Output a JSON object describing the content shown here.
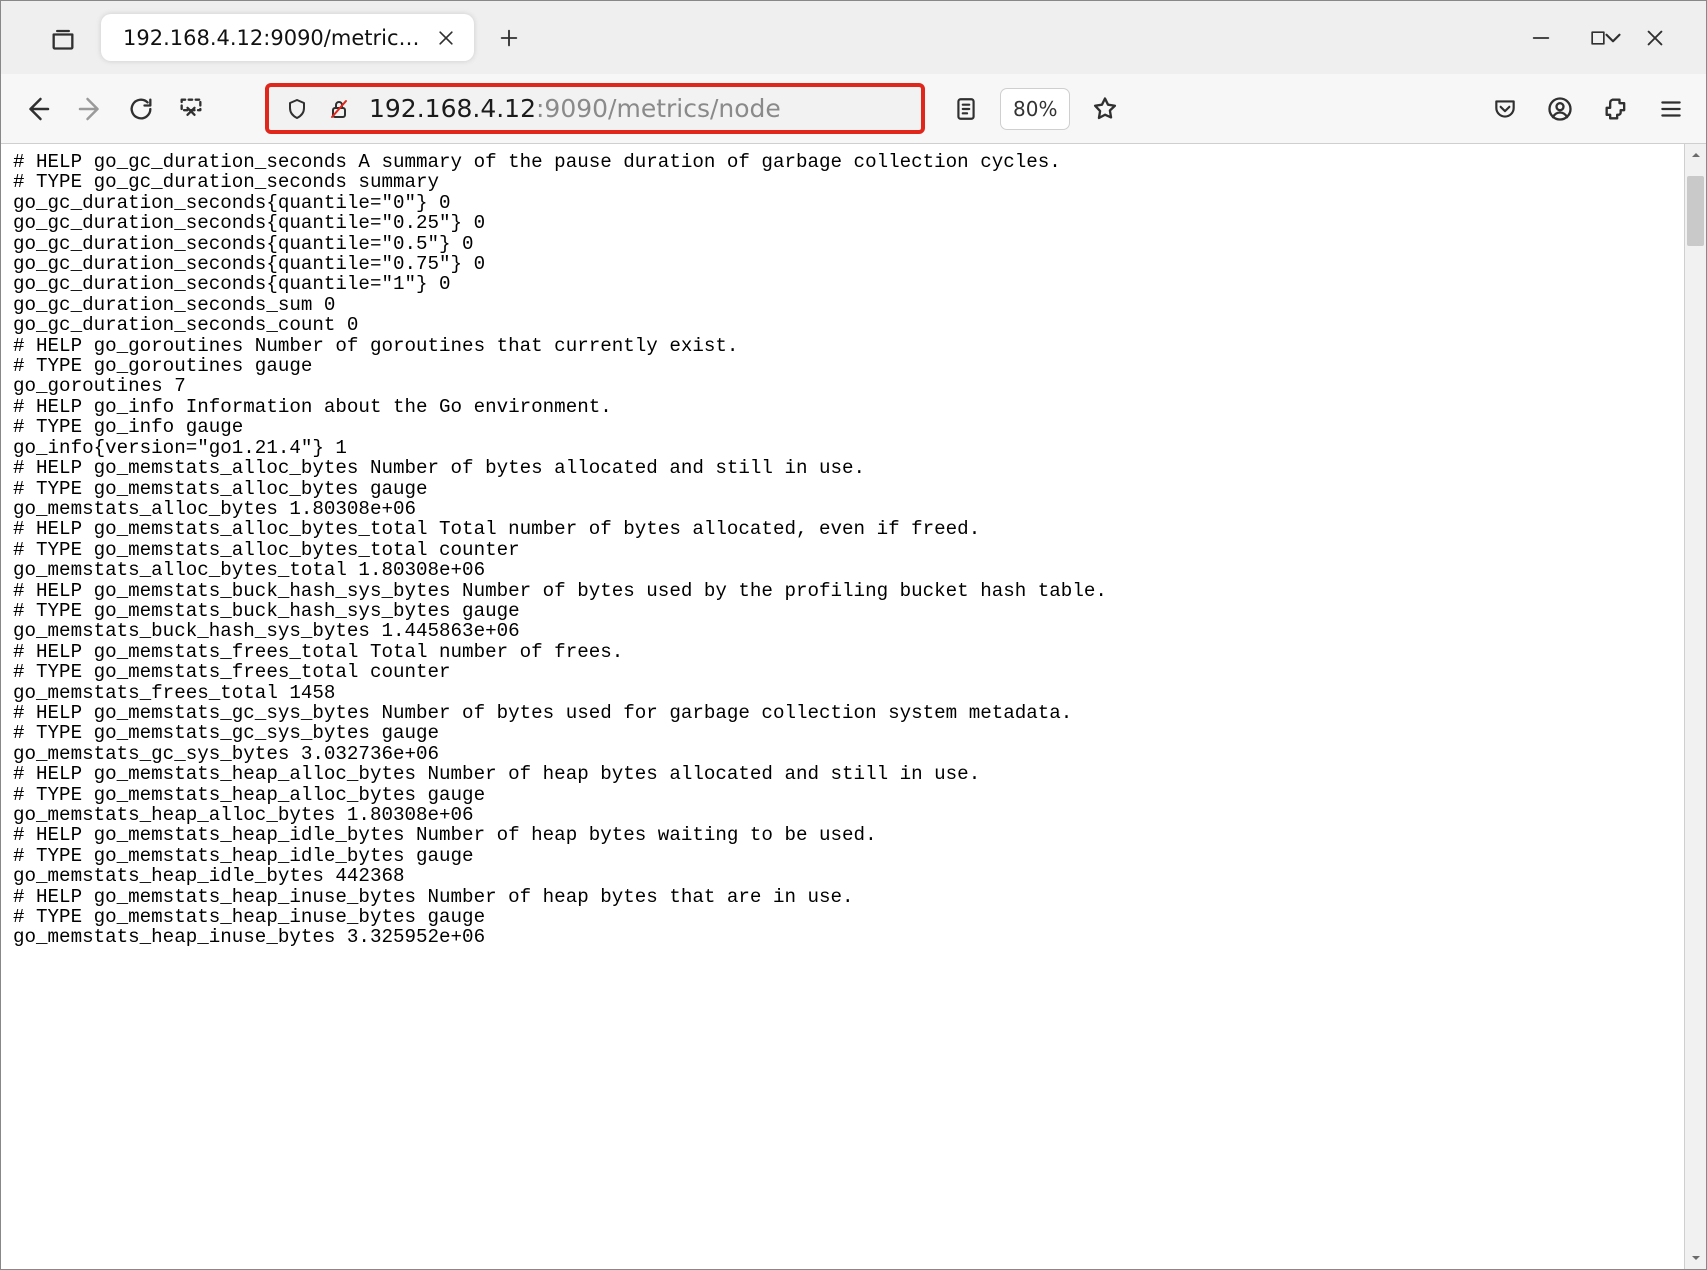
{
  "tab": {
    "title": "192.168.4.12:9090/metrics/node"
  },
  "address": {
    "host": "192.168.4.12",
    "port_path": ":9090/metrics/node"
  },
  "zoom": "80%",
  "highlight_color": "#e1261c",
  "metrics_lines": [
    "# HELP go_gc_duration_seconds A summary of the pause duration of garbage collection cycles.",
    "# TYPE go_gc_duration_seconds summary",
    "go_gc_duration_seconds{quantile=\"0\"} 0",
    "go_gc_duration_seconds{quantile=\"0.25\"} 0",
    "go_gc_duration_seconds{quantile=\"0.5\"} 0",
    "go_gc_duration_seconds{quantile=\"0.75\"} 0",
    "go_gc_duration_seconds{quantile=\"1\"} 0",
    "go_gc_duration_seconds_sum 0",
    "go_gc_duration_seconds_count 0",
    "# HELP go_goroutines Number of goroutines that currently exist.",
    "# TYPE go_goroutines gauge",
    "go_goroutines 7",
    "# HELP go_info Information about the Go environment.",
    "# TYPE go_info gauge",
    "go_info{version=\"go1.21.4\"} 1",
    "# HELP go_memstats_alloc_bytes Number of bytes allocated and still in use.",
    "# TYPE go_memstats_alloc_bytes gauge",
    "go_memstats_alloc_bytes 1.80308e+06",
    "# HELP go_memstats_alloc_bytes_total Total number of bytes allocated, even if freed.",
    "# TYPE go_memstats_alloc_bytes_total counter",
    "go_memstats_alloc_bytes_total 1.80308e+06",
    "# HELP go_memstats_buck_hash_sys_bytes Number of bytes used by the profiling bucket hash table.",
    "# TYPE go_memstats_buck_hash_sys_bytes gauge",
    "go_memstats_buck_hash_sys_bytes 1.445863e+06",
    "# HELP go_memstats_frees_total Total number of frees.",
    "# TYPE go_memstats_frees_total counter",
    "go_memstats_frees_total 1458",
    "# HELP go_memstats_gc_sys_bytes Number of bytes used for garbage collection system metadata.",
    "# TYPE go_memstats_gc_sys_bytes gauge",
    "go_memstats_gc_sys_bytes 3.032736e+06",
    "# HELP go_memstats_heap_alloc_bytes Number of heap bytes allocated and still in use.",
    "# TYPE go_memstats_heap_alloc_bytes gauge",
    "go_memstats_heap_alloc_bytes 1.80308e+06",
    "# HELP go_memstats_heap_idle_bytes Number of heap bytes waiting to be used.",
    "# TYPE go_memstats_heap_idle_bytes gauge",
    "go_memstats_heap_idle_bytes 442368",
    "# HELP go_memstats_heap_inuse_bytes Number of heap bytes that are in use.",
    "# TYPE go_memstats_heap_inuse_bytes gauge",
    "go_memstats_heap_inuse_bytes 3.325952e+06"
  ]
}
